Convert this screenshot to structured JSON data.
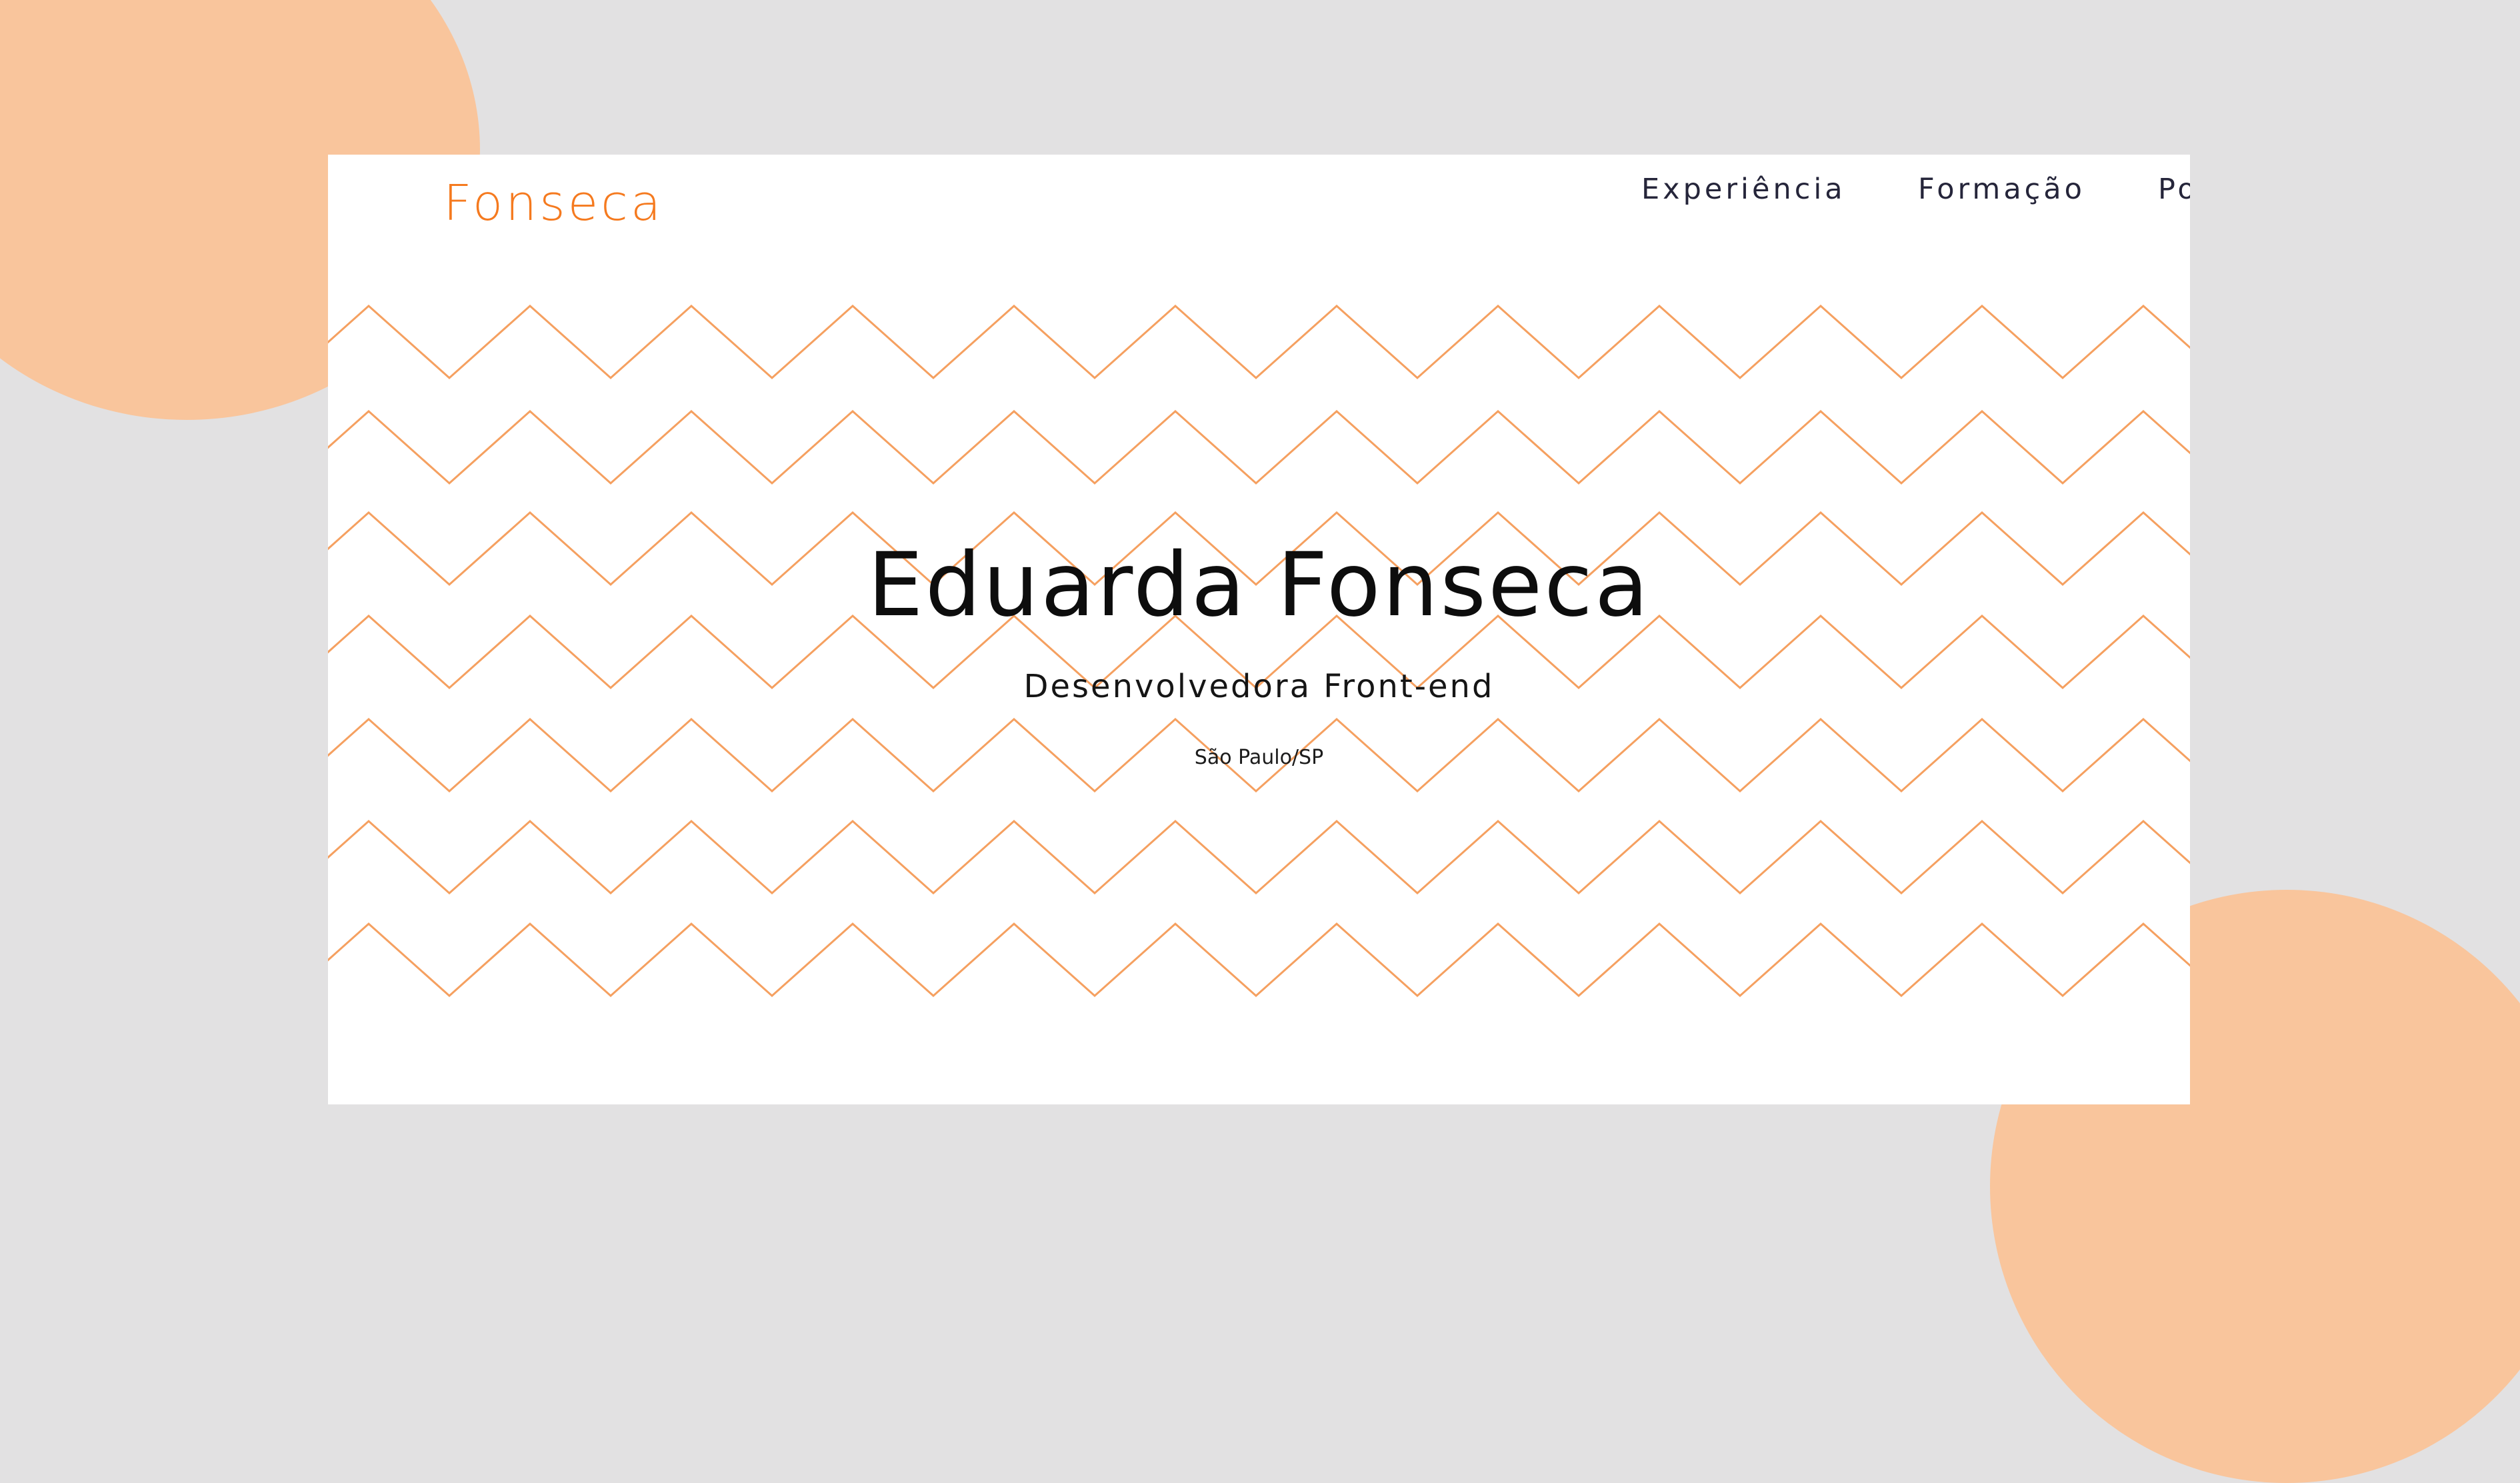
{
  "brand": {
    "name": "Fonseca",
    "accent_color": "#f57a1f"
  },
  "nav": {
    "items": [
      {
        "label": "Experiência"
      },
      {
        "label": "Formação"
      },
      {
        "label": "Portfólio"
      }
    ],
    "theme_toggle": {
      "icon": "theme-toggle-icon",
      "state": "off"
    }
  },
  "hero": {
    "name": "Eduarda Fonseca",
    "role": "Desenvolvedora Front-end",
    "location": "São Paulo/SP"
  },
  "decor": {
    "background_color": "#e2e1e2",
    "blob_color": "#f9c59c",
    "zigzag_color": "#f5a060"
  }
}
